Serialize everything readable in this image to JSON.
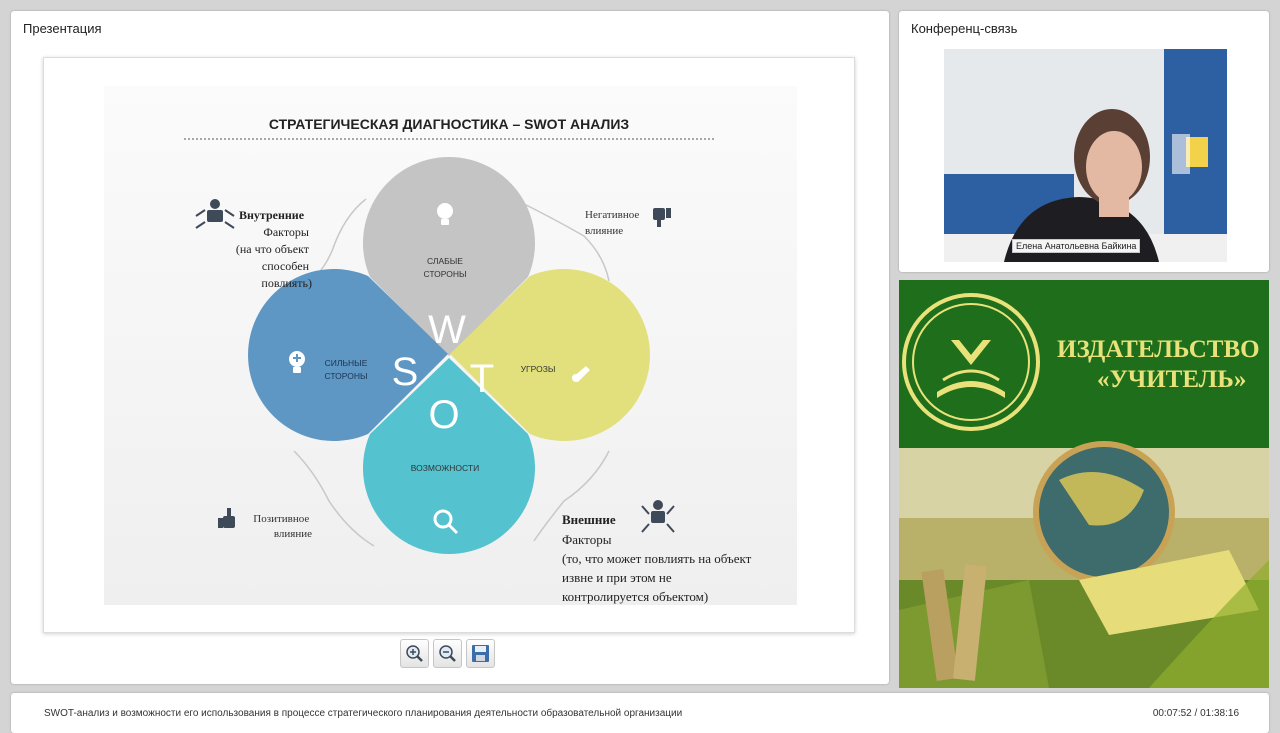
{
  "presentation": {
    "panel_title": "Презентация"
  },
  "slide": {
    "title": "СТРАТЕГИЧЕСКАЯ ДИАГНОСТИКА – SWOT АНАЛИЗ",
    "petals": {
      "weaknesses": "СЛАБЫЕ\nСТОРОНЫ",
      "strengths": "СИЛЬНЫЕ\nСТОРОНЫ",
      "threats": "УГРОЗЫ",
      "opportunities": "ВОЗМОЖНОСТИ"
    },
    "letters": {
      "w": "W",
      "s": "S",
      "t": "T",
      "o": "O"
    },
    "internal": {
      "heading": "Внутренние",
      "lines": [
        "Факторы",
        "(на что объект",
        "способен",
        "повлиять)"
      ]
    },
    "negative": {
      "lines": [
        "Негативное",
        "влияние"
      ]
    },
    "positive": {
      "lines": [
        "Позитивное",
        "влияние"
      ]
    },
    "external": {
      "heading": "Внешние",
      "lines": [
        "Факторы",
        "(то, что может повлиять на объект",
        "извне и при этом не",
        "контролируется объектом)"
      ]
    }
  },
  "toolbar": {
    "zoom_in": "zoom-in-icon",
    "zoom_out": "zoom-out-icon",
    "save": "floppy-disk-icon"
  },
  "conference": {
    "panel_title": "Конференц-связь",
    "speaker_name": "Елена Анатольевна Байкина"
  },
  "publisher": {
    "line1": "ИЗДАТЕЛЬСТВО",
    "line2": "«УЧИТЕЛЬ»"
  },
  "footer": {
    "lecture_title": "SWOT-анализ и возможности его использования в процессе стратегического планирования деятельности образовательной организации",
    "time": "00:07:52 / 01:38:16"
  },
  "colors": {
    "weaknesses": "#c4c4c4",
    "strengths": "#5e96c4",
    "threats": "#e1e07c",
    "opportunities": "#54c2cf",
    "publisher_green": "#1f6e1b",
    "publisher_gold": "#e9e27a"
  }
}
